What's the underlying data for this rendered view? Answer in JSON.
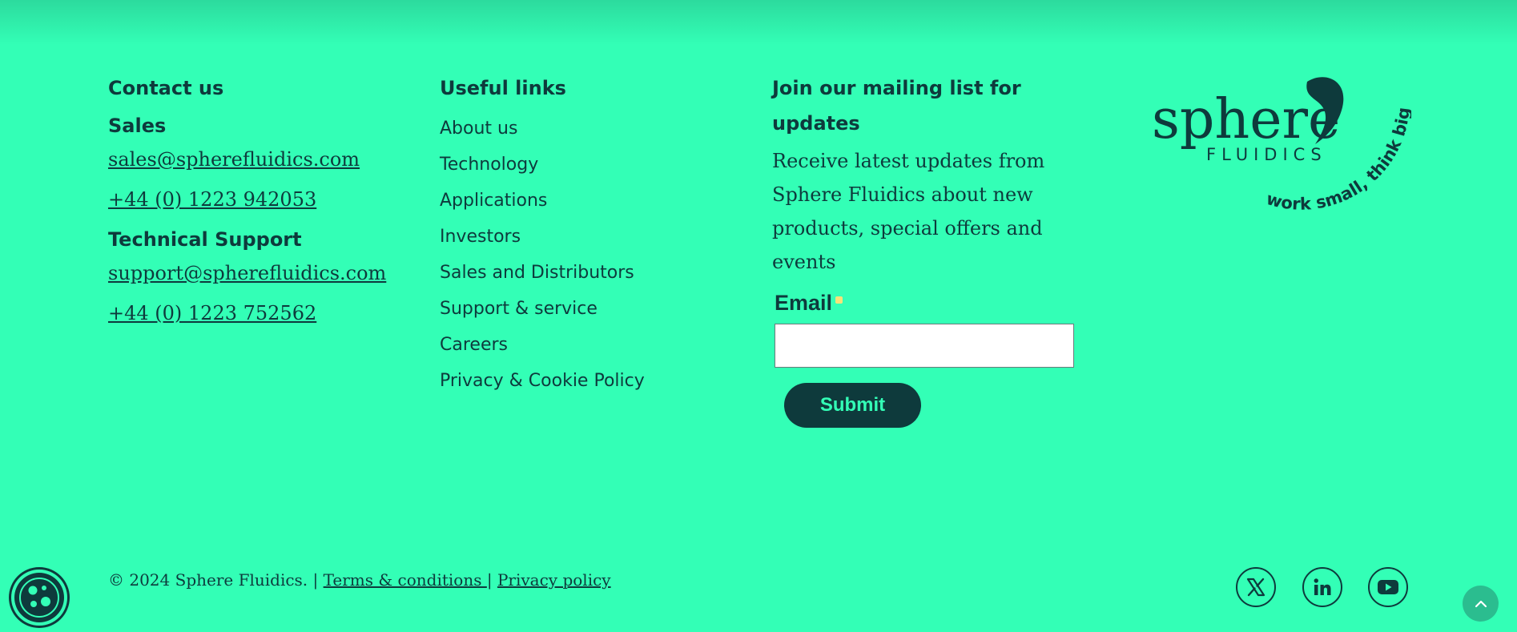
{
  "contact": {
    "heading": "Contact us",
    "sales_heading": "Sales",
    "sales_email": "sales@spherefluidics.com",
    "sales_phone": "+44 (0) 1223 942053",
    "support_heading": "Technical Support",
    "support_email": "support@spherefluidics.com",
    "support_phone": "+44 (0) 1223 752562"
  },
  "links": {
    "heading": "Useful links",
    "items": [
      {
        "label": "About us"
      },
      {
        "label": "Technology"
      },
      {
        "label": "Applications"
      },
      {
        "label": "Investors"
      },
      {
        "label": "Sales and Distributors"
      },
      {
        "label": "Support & service"
      },
      {
        "label": "Careers"
      },
      {
        "label": "Privacy & Cookie Policy"
      }
    ]
  },
  "mailing": {
    "heading": "Join our mailing list for updates",
    "description": "Receive latest updates from Sphere Fluidics about new products, special offers and events",
    "email_label": "Email",
    "email_value": "",
    "submit_label": "Submit"
  },
  "logo": {
    "word": "sphere",
    "subword": "FLUIDICS",
    "tagline": "work small, think big"
  },
  "footer": {
    "copyright": "© 2024 Sphere Fluidics. |",
    "terms_label": "Terms & conditions ",
    "separator": "|",
    "privacy_label": "Privacy policy"
  },
  "social": {
    "icons": [
      "x-icon",
      "linkedin-icon",
      "youtube-icon"
    ]
  },
  "colors": {
    "background": "#33ffb6",
    "primary": "#0e3a3c",
    "accent": "#33ffb6",
    "input_bg": "#ffffff"
  }
}
